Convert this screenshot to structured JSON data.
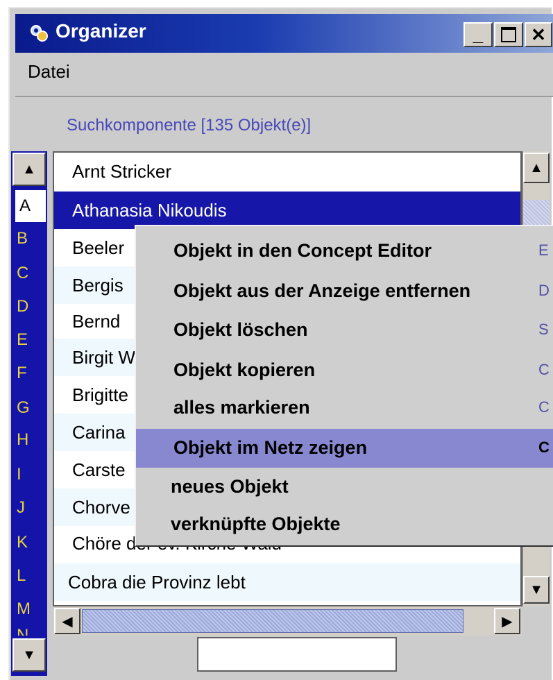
{
  "window": {
    "title": "Organizer"
  },
  "menubar": {
    "items": [
      "Datei"
    ]
  },
  "search": {
    "label": "Suchkomponente  [135 Objekt(e)]"
  },
  "alphabet": [
    "A",
    "B",
    "C",
    "D",
    "E",
    "F",
    "G",
    "H",
    "I",
    "J",
    "K",
    "L",
    "M",
    "N"
  ],
  "list": {
    "rows": [
      "Arnt Stricker",
      "Athanasia Nikoudis",
      "Beeler",
      "Bergis",
      "Bernd",
      "Birgit W",
      "Brigitte",
      "Carina",
      "Carste",
      "Chorve",
      "Chöre der ev. Kirche Wald",
      "Cobra die Provinz lebt"
    ],
    "selected_index": 1
  },
  "context_menu": {
    "items": [
      {
        "label": "Objekt in den Concept Editor",
        "shortcut": "E"
      },
      {
        "label": "Objekt aus der Anzeige entfernen",
        "shortcut": "D"
      },
      {
        "label": "Objekt löschen",
        "shortcut": "S"
      },
      {
        "label": "Objekt kopieren",
        "shortcut": "C"
      },
      {
        "label": "alles markieren",
        "shortcut": "C"
      },
      {
        "label": "Objekt im Netz zeigen",
        "shortcut": "C"
      },
      {
        "label": "neues Objekt",
        "shortcut": ""
      },
      {
        "label": "verknüpfte Objekte",
        "shortcut": ""
      }
    ],
    "highlighted_index": 5
  },
  "colors": {
    "title_start": "#0a1a8c",
    "selection": "#1616a8",
    "highlight": "#8888d0",
    "alpha_panel": "#1414a8"
  },
  "icons": [
    "app-icon",
    "minimize-icon",
    "maximize-icon",
    "close-icon",
    "arrow-up-icon",
    "arrow-down-icon",
    "arrow-left-icon",
    "arrow-right-icon"
  ]
}
